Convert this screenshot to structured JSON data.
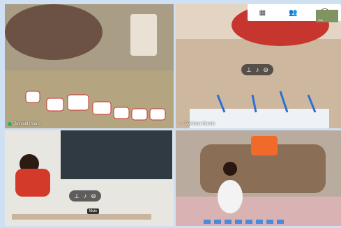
{
  "participants": [
    {
      "name": "Jayvald Imani"
    },
    {
      "name": "Svetlana Mande"
    },
    {
      "name": ""
    },
    {
      "name": ""
    }
  ],
  "tile_controls": {
    "pin_icon": "pin-icon",
    "mic_icon": "mic-icon",
    "remove_icon": "remove-icon"
  },
  "tooltip": {
    "text": "Mute"
  },
  "top_bar": {
    "icons": [
      "layout-icon",
      "people-icon",
      "chat-icon"
    ],
    "self_view_label": "You"
  },
  "colors": {
    "accent": "#1fb26a",
    "background": "#cfe0f3"
  }
}
